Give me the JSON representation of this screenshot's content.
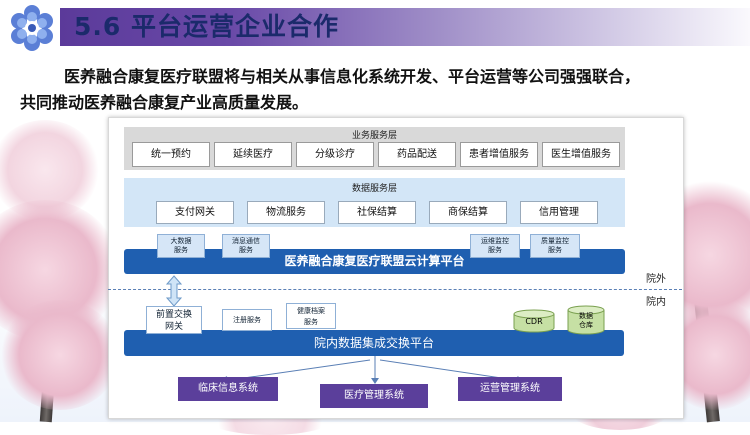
{
  "header": {
    "title": "5.6 平台运营企业合作",
    "intro_line1": "医养融合康复医疗联盟将与相关从事信息化系统开发、平台运营等公司强强联合，",
    "intro_line2": "共同推动医养融合康复产业高质量发展。"
  },
  "diagram": {
    "business_layer": {
      "label": "业务服务层",
      "items": [
        "统一预约",
        "延续医疗",
        "分级诊疗",
        "药品配送",
        "患者增值服务",
        "医生增值服务"
      ]
    },
    "data_layer": {
      "label": "数据服务层",
      "items": [
        "支付网关",
        "物流服务",
        "社保结算",
        "商保结算",
        "信用管理"
      ]
    },
    "cloud_tags_left": [
      {
        "line1": "大数据",
        "line2": "服务"
      },
      {
        "line1": "消息通信",
        "line2": "服务"
      }
    ],
    "cloud_tags_right": [
      {
        "line1": "运维监控",
        "line2": "服务"
      },
      {
        "line1": "质量监控",
        "line2": "服务"
      }
    ],
    "cloud_platform": "医养融合康复医疗联盟云计算平台",
    "zone_outside": "院外",
    "zone_inside": "院内",
    "gateway": {
      "line1": "前置交换",
      "line2": "网关"
    },
    "hospital_tags": [
      {
        "line1": "注册服务",
        "line2": ""
      },
      {
        "line1": "健康档案",
        "line2": "服务"
      }
    ],
    "cylinders": [
      {
        "line1": "CDR",
        "line2": ""
      },
      {
        "line1": "数据",
        "line2": "仓库"
      }
    ],
    "hospital_platform": "院内数据集成交换平台",
    "systems": [
      "临床信息系统",
      "医疗管理系统",
      "运营管理系统"
    ]
  },
  "colors": {
    "title_band": "#5b3a9a",
    "platform_blue": "#1f5fb0",
    "system_purple": "#5b3f9b",
    "data_layer_bg": "#d3e6f7",
    "business_layer_bg": "#d9d9d9"
  }
}
